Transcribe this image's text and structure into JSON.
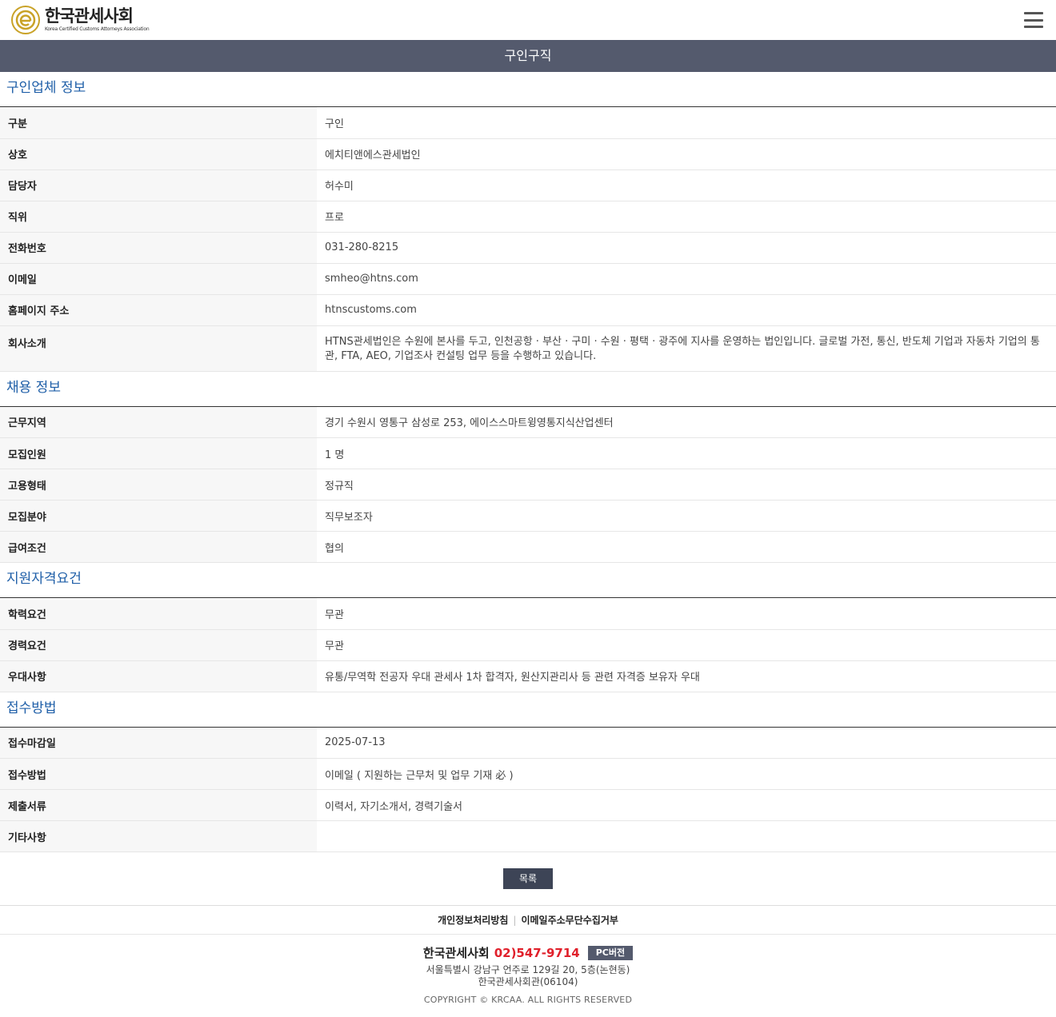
{
  "header": {
    "logo_ko": "한국관세사회",
    "logo_en": "Korea Certified Customs Attorneys Association",
    "menu_icon": "hamburger-menu-icon"
  },
  "page_title": "구인구직",
  "sections": {
    "company": {
      "title": "구인업체 정보",
      "rows": [
        {
          "label": "구분",
          "value": "구인"
        },
        {
          "label": "상호",
          "value": "에치티앤에스관세법인"
        },
        {
          "label": "담당자",
          "value": "허수미"
        },
        {
          "label": "직위",
          "value": "프로"
        },
        {
          "label": "전화번호",
          "value": "031-280-8215"
        },
        {
          "label": "이메일",
          "value": "smheo@htns.com"
        },
        {
          "label": "홈페이지 주소",
          "value": "htnscustoms.com"
        },
        {
          "label": "회사소개",
          "value": "HTNS관세법인은 수원에 본사를 두고, 인천공항 · 부산 · 구미 · 수원 · 평택 · 광주에 지사를 운영하는 법인입니다. 글로벌 가전, 통신, 반도체 기업과 자동차 기업의 통관, FTA, AEO, 기업조사 컨설팅 업무 등을 수행하고 있습니다."
        }
      ]
    },
    "job": {
      "title": "채용 정보",
      "rows": [
        {
          "label": "근무지역",
          "value": "경기 수원시 영통구 삼성로 253, 에이스스마트윙영통지식산업센터"
        },
        {
          "label": "모집인원",
          "value": "1 명"
        },
        {
          "label": "고용형태",
          "value": "정규직"
        },
        {
          "label": "모집분야",
          "value": "직무보조자"
        },
        {
          "label": "급여조건",
          "value": "협의"
        }
      ]
    },
    "qualification": {
      "title": "지원자격요건",
      "rows": [
        {
          "label": "학력요건",
          "value": "무관"
        },
        {
          "label": "경력요건",
          "value": "무관"
        },
        {
          "label": "우대사항",
          "value": "유통/무역학 전공자 우대 관세사 1차 합격자, 원산지관리사 등 관련 자격증 보유자 우대"
        }
      ]
    },
    "application": {
      "title": "접수방법",
      "rows": [
        {
          "label": "접수마감일",
          "value": "2025-07-13"
        },
        {
          "label": "접수방법",
          "value": "이메일 ( 지원하는 근무처 및 업무 기재 必 )"
        },
        {
          "label": "제출서류",
          "value": "이력서, 자기소개서, 경력기술서"
        },
        {
          "label": "기타사항",
          "value": ""
        }
      ]
    }
  },
  "list_button": "목록",
  "footer": {
    "links": [
      "개인정보처리방침",
      "이메일주소무단수집거부"
    ],
    "org": "한국관세사회",
    "phone": "02)547-9714",
    "pc_button": "PC버전",
    "address1": "서울특별시 강남구 언주로 129길 20, 5층(논현동)",
    "address2": "한국관세사회관(06104)",
    "copyright": "COPYRIGHT © KRCAA. ALL RIGHTS RESERVED"
  },
  "colors": {
    "title_bar": "#545a6d",
    "section_title": "#1f5fa8",
    "phone": "#e0202b",
    "logo_gold": "#c9a227"
  }
}
